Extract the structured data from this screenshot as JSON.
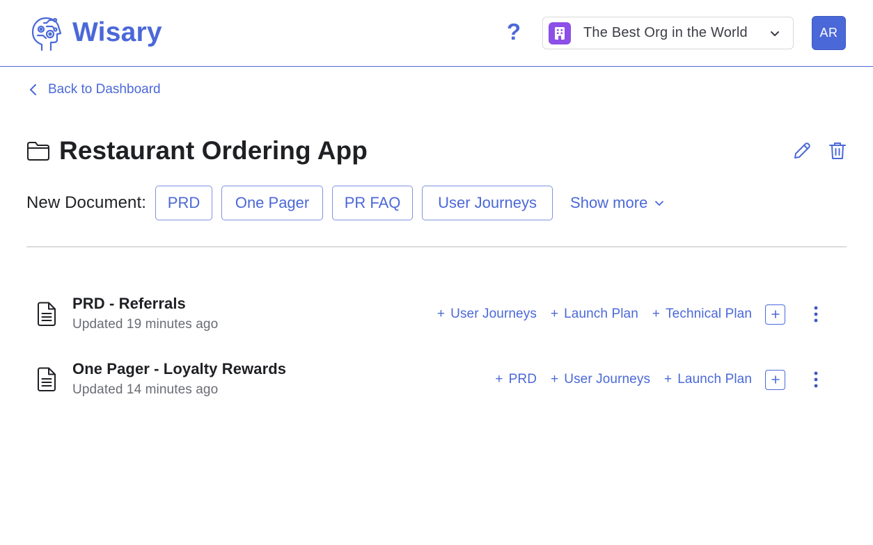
{
  "header": {
    "brand": "Wisary",
    "help_label": "?",
    "org_name": "The Best Org in the World",
    "avatar_initials": "AR",
    "accent_color": "#4b68d8",
    "org_badge_color": "#8c4fe8"
  },
  "nav": {
    "back_label": "Back to Dashboard"
  },
  "project": {
    "title": "Restaurant Ordering App"
  },
  "new_document": {
    "label": "New Document:",
    "templates": [
      "PRD",
      "One Pager",
      "PR FAQ",
      "User Journeys"
    ],
    "show_more": "Show more"
  },
  "documents": [
    {
      "title": "PRD - Referrals",
      "updated": "Updated 19 minutes ago",
      "actions": [
        "User Journeys",
        "Launch Plan",
        "Technical Plan"
      ]
    },
    {
      "title": "One Pager - Loyalty Rewards",
      "updated": "Updated 14 minutes ago",
      "actions": [
        "PRD",
        "User Journeys",
        "Launch Plan"
      ]
    }
  ],
  "icons": {
    "logo": "brain-gears-icon",
    "org": "building-icon",
    "back": "chevron-left-icon",
    "folder": "folder-icon",
    "edit": "pencil-icon",
    "delete": "trash-icon",
    "document": "document-icon",
    "more": "kebab-icon"
  }
}
